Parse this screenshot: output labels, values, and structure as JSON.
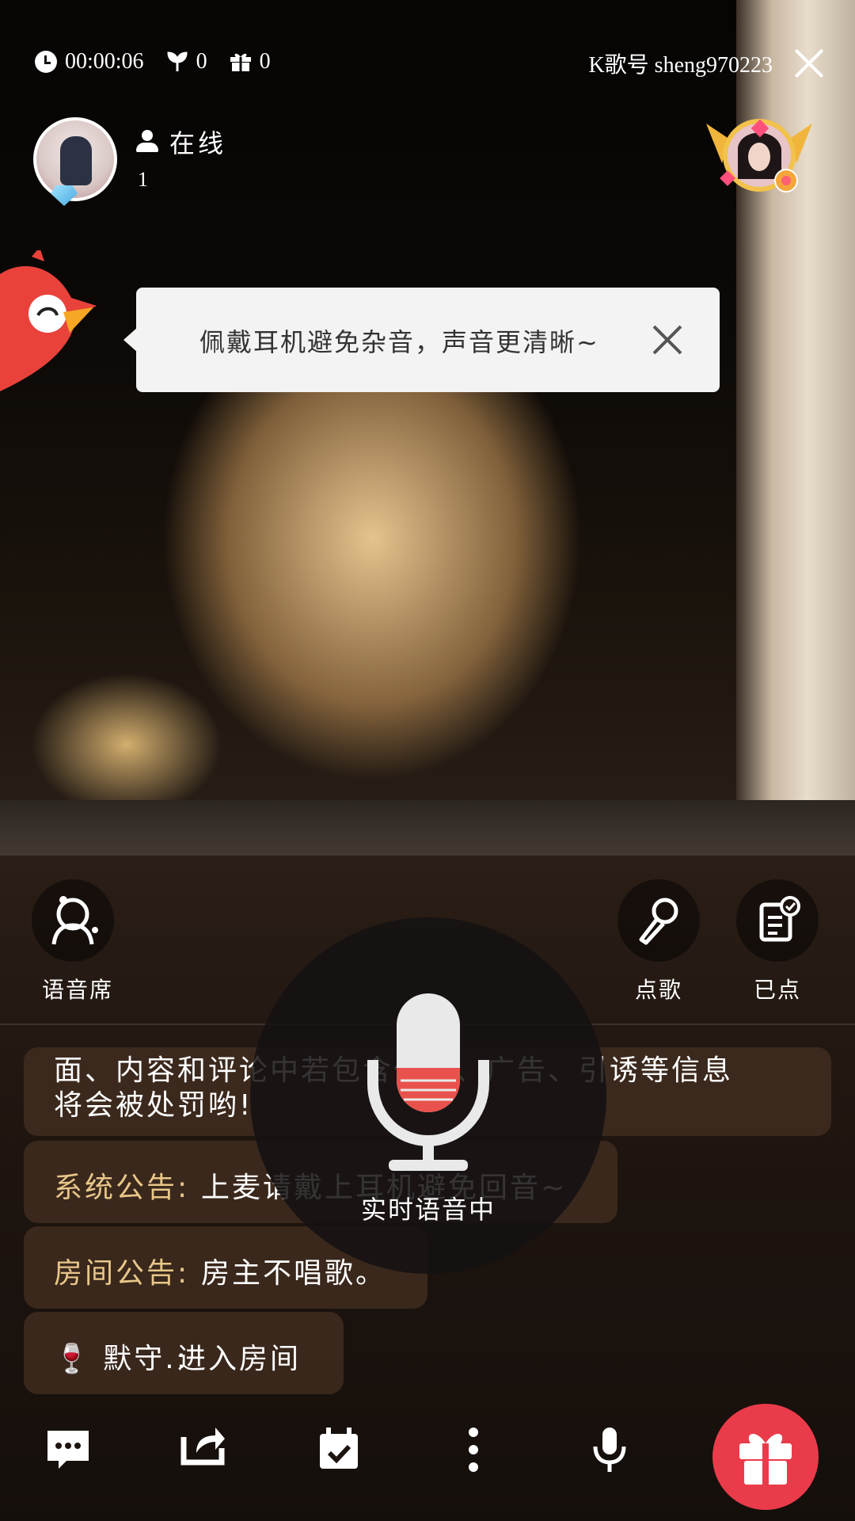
{
  "status_bar": {
    "timer": "00:00:06",
    "flowers": "0",
    "gifts": "0",
    "kid_label": "K歌号 sheng970223"
  },
  "host": {
    "online_label": "在线",
    "online_count": "1"
  },
  "tooltip": {
    "text": "佩戴耳机避免杂音，声音更清晰~"
  },
  "panel": {
    "voice_seat_label": "语音席",
    "order_song_label": "点歌",
    "ordered_label": "已点"
  },
  "chat": [
    {
      "speaker": "",
      "text": "面、内容和评论中若包含低俗、广告、引诱等信息",
      "text2": "将会被处罚哟!"
    },
    {
      "speaker": "系统公告:",
      "text": "上麦请戴上耳机避免回音~"
    },
    {
      "speaker": "房间公告:",
      "text": "房主不唱歌。"
    },
    {
      "speaker": "🍷 默守.:",
      "text": "进入房间"
    }
  ],
  "mic": {
    "label": "实时语音中"
  },
  "colors": {
    "accent_red": "#ea3b4a",
    "announcement_gold": "#e8c78a"
  }
}
